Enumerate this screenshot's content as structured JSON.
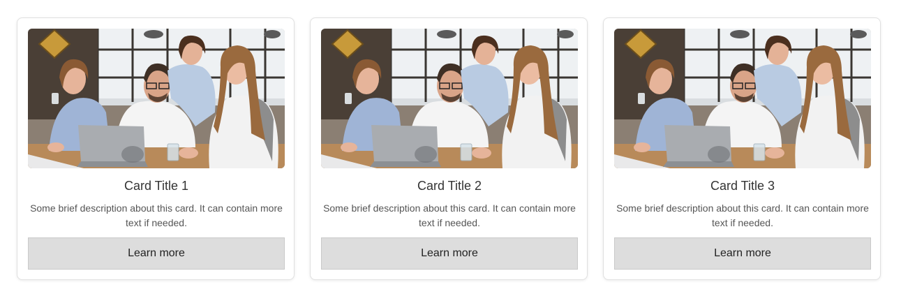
{
  "cards": [
    {
      "title": "Card Title 1",
      "description": "Some brief description about this card. It can contain more text if needed.",
      "button_label": "Learn more",
      "image": "team-office-photo"
    },
    {
      "title": "Card Title 2",
      "description": "Some brief description about this card. It can contain more text if needed.",
      "button_label": "Learn more",
      "image": "team-office-photo"
    },
    {
      "title": "Card Title 3",
      "description": "Some brief description about this card. It can contain more text if needed.",
      "button_label": "Learn more",
      "image": "team-office-photo"
    }
  ],
  "colors": {
    "card_border": "#e0e0e0",
    "button_background": "#dddddd",
    "title_text": "#333333",
    "description_text": "#555555"
  }
}
